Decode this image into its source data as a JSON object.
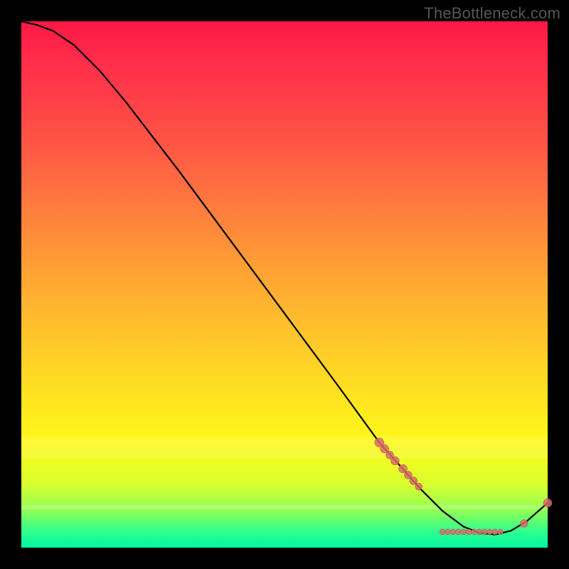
{
  "watermark": "TheBottleneck.com",
  "chart_data": {
    "type": "line",
    "title": "",
    "xlabel": "",
    "ylabel": "",
    "xlim": [
      0,
      100
    ],
    "ylim": [
      0,
      100
    ],
    "grid": false,
    "curve": [
      {
        "x": 0,
        "y": 100
      },
      {
        "x": 3,
        "y": 99.3
      },
      {
        "x": 6,
        "y": 98.2
      },
      {
        "x": 10,
        "y": 95.5
      },
      {
        "x": 15,
        "y": 90.5
      },
      {
        "x": 20,
        "y": 84.5
      },
      {
        "x": 30,
        "y": 71.5
      },
      {
        "x": 40,
        "y": 58
      },
      {
        "x": 50,
        "y": 44.5
      },
      {
        "x": 60,
        "y": 31
      },
      {
        "x": 68,
        "y": 20
      },
      {
        "x": 72,
        "y": 15.5
      },
      {
        "x": 76,
        "y": 11
      },
      {
        "x": 80,
        "y": 7
      },
      {
        "x": 84,
        "y": 4
      },
      {
        "x": 87,
        "y": 2.8
      },
      {
        "x": 90,
        "y": 2.5
      },
      {
        "x": 93,
        "y": 3.2
      },
      {
        "x": 96,
        "y": 5
      },
      {
        "x": 100,
        "y": 8.5
      }
    ],
    "markers_dense": [
      {
        "x": 68,
        "y": 20,
        "r": 6.5
      },
      {
        "x": 69,
        "y": 18.8,
        "r": 6
      },
      {
        "x": 70,
        "y": 17.6,
        "r": 5.5
      },
      {
        "x": 71,
        "y": 16.5,
        "r": 6
      },
      {
        "x": 72.5,
        "y": 15,
        "r": 6
      },
      {
        "x": 73.5,
        "y": 13.8,
        "r": 5.5
      },
      {
        "x": 74.5,
        "y": 12.7,
        "r": 5.5
      },
      {
        "x": 75.5,
        "y": 11.6,
        "r": 5
      }
    ],
    "markers_bottom": [
      {
        "x": 80,
        "y": 3,
        "r": 4
      },
      {
        "x": 81,
        "y": 3,
        "r": 4
      },
      {
        "x": 82,
        "y": 3,
        "r": 4
      },
      {
        "x": 83,
        "y": 3,
        "r": 4
      },
      {
        "x": 84,
        "y": 3,
        "r": 4
      },
      {
        "x": 85,
        "y": 3,
        "r": 4
      },
      {
        "x": 86,
        "y": 3,
        "r": 4
      },
      {
        "x": 87,
        "y": 3,
        "r": 4
      },
      {
        "x": 88,
        "y": 3,
        "r": 4
      },
      {
        "x": 89,
        "y": 3,
        "r": 4
      },
      {
        "x": 90,
        "y": 3,
        "r": 4
      },
      {
        "x": 91,
        "y": 3,
        "r": 4
      }
    ],
    "markers_tail": [
      {
        "x": 95.5,
        "y": 4.6,
        "r": 5.5
      },
      {
        "x": 100,
        "y": 8.5,
        "r": 6
      }
    ]
  }
}
